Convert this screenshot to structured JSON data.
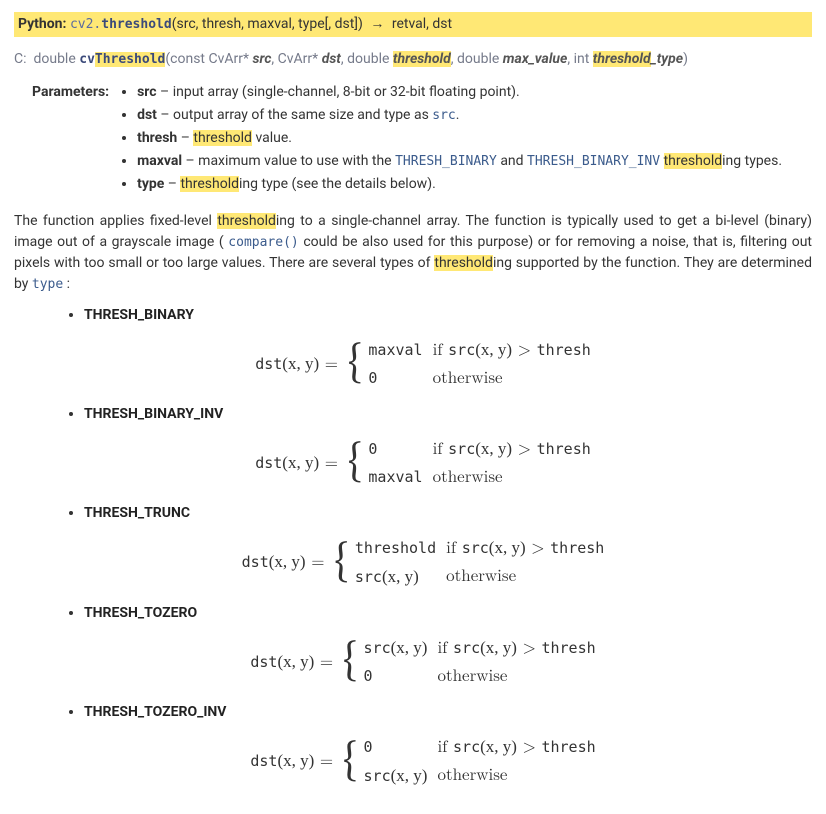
{
  "sig_py": {
    "lang": "Python:",
    "pre_fn": "cv2.",
    "fn": "threshold",
    "args": "(src, thresh, maxval, type[, dst])",
    "arrow": "→",
    "ret": "retval, dst"
  },
  "sig_c": {
    "lang": "C:",
    "ret_type": "double",
    "fn_prefix": "cv",
    "fn": "Threshold",
    "a0t": "const CvArr*",
    "a0n": "src",
    "a1t": "CvArr*",
    "a1n": "dst",
    "a2t": "double",
    "a2n": "threshold",
    "a3t": "double",
    "a3n": "max_value",
    "a4t": "int",
    "a4n_pre": "threshold",
    "a4n_suf": "_type"
  },
  "params_label": "Parameters:",
  "params": {
    "p0": {
      "name": "src",
      "desc": " – input array (single-channel, 8-bit or 32-bit floating point)."
    },
    "p1": {
      "name": "dst",
      "desc_a": " – output array of the same size and type as ",
      "code": "src",
      "desc_b": "."
    },
    "p2": {
      "name": "thresh",
      "desc_a": " – ",
      "hl": "threshold",
      "desc_b": " value."
    },
    "p3": {
      "name": "maxval",
      "desc_a": " – maximum value to use with the ",
      "code1": "THRESH_BINARY",
      "mid": " and ",
      "code2": "THRESH_BINARY_INV",
      "sp": " ",
      "hl": "threshold",
      "desc_b": "ing types."
    },
    "p4": {
      "name": "type",
      "desc_a": " – ",
      "hl": "threshold",
      "desc_b": "ing type (see the details below)."
    }
  },
  "desc": {
    "a": "The function applies fixed-level ",
    "hl1": "threshold",
    "b": "ing to a single-channel array. The function is typically used to get a bi-level (binary) image out of a grayscale image ( ",
    "code": "compare()",
    "c": " could be also used for this purpose) or for removing a noise, that is, filtering out pixels with too small or too large values. There are several types of ",
    "hl2": "threshold",
    "d": "ing supported by the function. They are determined by ",
    "code2": "type",
    "e": " :"
  },
  "types": {
    "t0": "THRESH_BINARY",
    "t1": "THRESH_BINARY_INV",
    "t2": "THRESH_TRUNC",
    "t3": "THRESH_TOZERO",
    "t4": "THRESH_TOZERO_INV"
  },
  "math": {
    "lhs": "dst",
    "eq": " = ",
    "args": "(x, y)",
    "gt": " > ",
    "maxval": "maxval",
    "zero": "0",
    "threshold": "threshold",
    "thresh": "thresh",
    "src": "src",
    "if": "if ",
    "otherwise": "otherwise"
  }
}
